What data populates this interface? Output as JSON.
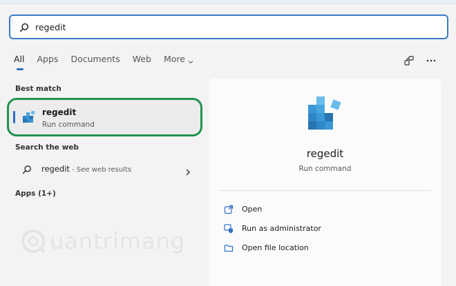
{
  "search": {
    "value": "regedit",
    "placeholder": ""
  },
  "tabs": [
    {
      "label": "All",
      "active": true
    },
    {
      "label": "Apps",
      "active": false
    },
    {
      "label": "Documents",
      "active": false
    },
    {
      "label": "Web",
      "active": false
    },
    {
      "label": "More",
      "active": false
    }
  ],
  "toolbar_icons": [
    "share-device-icon",
    "more-options-icon"
  ],
  "best_match": {
    "section_label": "Best match",
    "title": "regedit",
    "subtitle": "Run command",
    "icon": "registry-editor-icon"
  },
  "web": {
    "section_label": "Search the web",
    "query": "regedit",
    "suffix": " - See web results"
  },
  "apps_section_label": "Apps (1+)",
  "preview": {
    "title": "regedit",
    "subtitle": "Run command",
    "icon": "registry-editor-icon",
    "actions": [
      {
        "label": "Open",
        "icon": "open-icon"
      },
      {
        "label": "Run as administrator",
        "icon": "shield-icon"
      },
      {
        "label": "Open file location",
        "icon": "folder-icon"
      }
    ]
  },
  "watermark": {
    "text": "uantrimang"
  },
  "colors": {
    "accent": "#2f6fc5",
    "highlight_border": "#1f9350",
    "background": "#f3f3f3",
    "pane": "#fbfbfb"
  }
}
